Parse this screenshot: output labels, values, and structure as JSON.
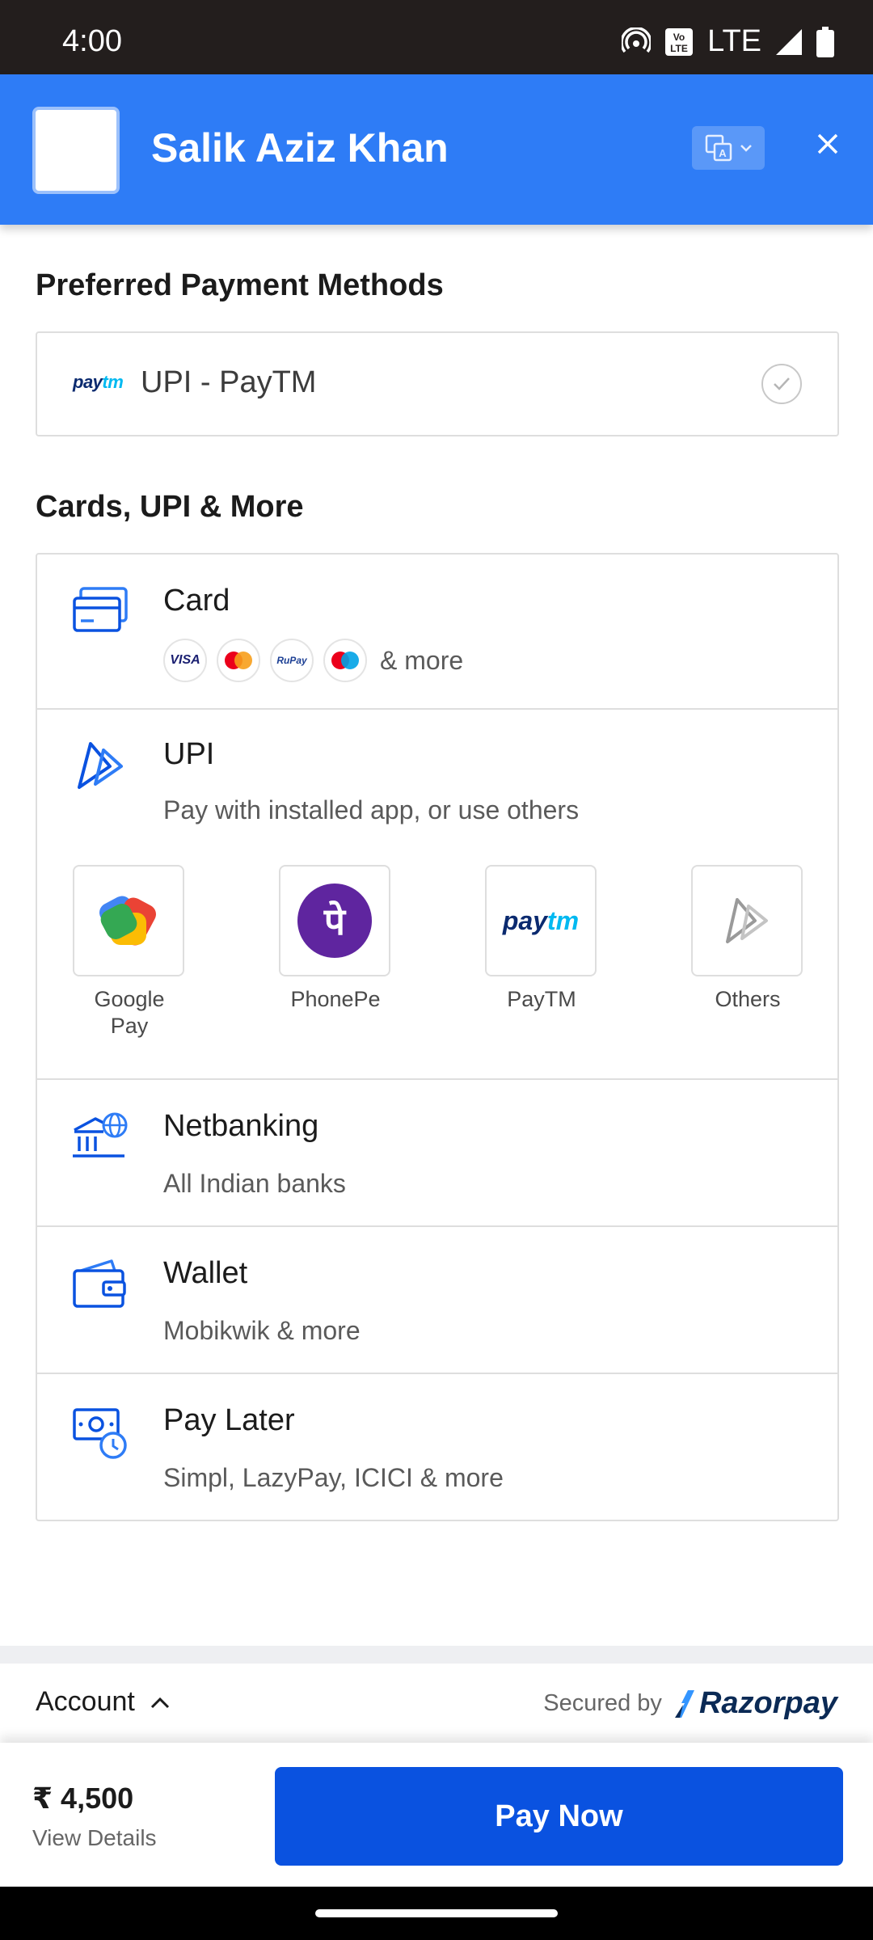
{
  "status_bar": {
    "time": "4:00",
    "network": "LTE",
    "volte": "VoLTE"
  },
  "header": {
    "merchant_name": "Salik Aziz Khan",
    "language_icon": "translate-icon",
    "close_icon": "close-icon",
    "background_color": "#2e7cf6"
  },
  "preferred": {
    "title": "Preferred Payment Methods",
    "item": {
      "logo_text": "paytm",
      "label": "UPI - PayTM"
    }
  },
  "methods": {
    "title": "Cards, UPI & More",
    "card": {
      "title": "Card",
      "brands": [
        "VISA",
        "Mastercard",
        "RuPay",
        "Maestro"
      ],
      "more": "& more"
    },
    "upi": {
      "title": "UPI",
      "subtitle": "Pay with installed app, or use others",
      "apps": [
        {
          "name": "Google Pay"
        },
        {
          "name": "PhonePe",
          "glyph": "पे"
        },
        {
          "name": "PayTM",
          "logo_text": "paytm"
        },
        {
          "name": "Others"
        }
      ]
    },
    "netbanking": {
      "title": "Netbanking",
      "subtitle": "All Indian banks"
    },
    "wallet": {
      "title": "Wallet",
      "subtitle": "Mobikwik & more"
    },
    "paylater": {
      "title": "Pay Later",
      "subtitle": "Simpl, LazyPay, ICICI & more"
    }
  },
  "footer": {
    "account_label": "Account",
    "secured_by": "Secured by",
    "razorpay": "Razorpay",
    "amount": "₹ 4,500",
    "view_details": "View Details",
    "pay_now": "Pay Now",
    "accent_color": "#0a52e0"
  }
}
